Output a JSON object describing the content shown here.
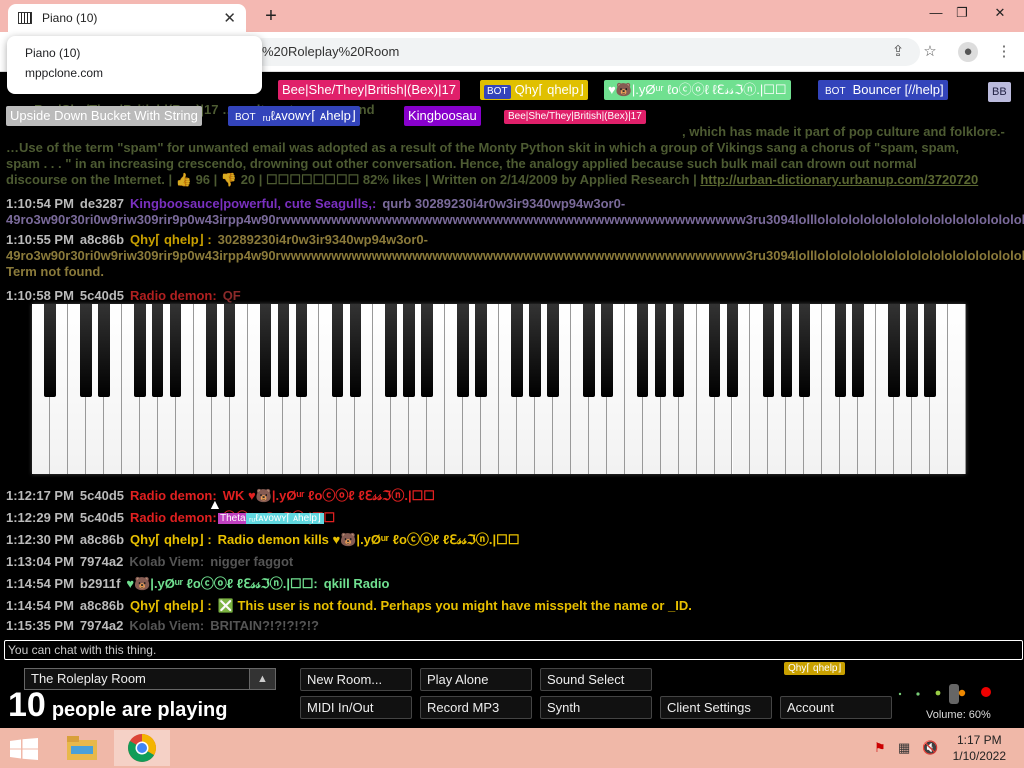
{
  "browser": {
    "tab_title": "Piano (10)",
    "new_tab": "+",
    "url": "%20Roleplay%20Room",
    "tooltip": {
      "title": "Piano (10)",
      "domain": "mppclone.com"
    },
    "win": {
      "min": "—",
      "max": "❐",
      "close": "✕"
    }
  },
  "userbar": {
    "tags": [
      {
        "label": "Bee|She/They|British|(Bex)|17",
        "bg": "#e0206a"
      },
      {
        "label": "Qhy⌈ qhelp⌋",
        "bg": "#e0c000",
        "bot": "BOT"
      },
      {
        "label": "♥🐻|.yØᵘʳ ℓoⓒⓞℓ ℓℇ𝓈𝓈ℑⓝ.|☐☐",
        "bg": "#70e090"
      },
      {
        "label": "Bouncer [//help]",
        "bg": "#3344bb",
        "bot": "BOT"
      },
      {
        "label": "BB",
        "bg": "#bbd"
      },
      {
        "label": "Upside Down Bucket With String",
        "bg": "#bbbbbb"
      },
      {
        "label": "ᵣᵤℓᴀᴠᴏᴡʏ⌈ ᴀhelp⌋",
        "bg": "#3344bb",
        "bot": "BOT"
      },
      {
        "label": "Kingboosau",
        "bg": "#8800cc"
      },
      {
        "label": "Bee|She/They|British|(Bex)|17",
        "bg": "#e0206a"
      }
    ]
  },
  "ghost": {
    "line1": "…m Bee|She/They|British|(Bex)|17 …, salt, water, sugar and",
    "line2": "…Use of the term \"spam\" for unwanted email was adopted as a result of the Monty Python skit in which a group of Vikings sang a chorus of \"spam, spam,",
    "line3": "spam . . . \" in an increasing crescendo, drowning out other conversation. Hence, the analogy applied because such bulk mail can drown out normal",
    "line4": "discourse on the Internet. | 👍 96 | 👎 20 | ☐☐☐☐☐☐☐☐ 82% likes | Written on 2/14/2009 by Applied Research |",
    "link": "http://urban-dictionary.urbanup.com/3720720",
    "extra": ", which has made it part of pop culture and folklore.-"
  },
  "chat": [
    {
      "time": "1:10:54 PM",
      "id": "de3287",
      "name": "Kingboosauce|powerful, cute Seagulls,:",
      "nameColor": "#7a30c0",
      "msg": "qurb 30289230i4r0w3ir9340wp94w3or0-",
      "msgColor": "#7a6a9a"
    },
    {
      "time": "",
      "id": "",
      "name": "",
      "nameColor": "#888",
      "msg": "49ro3w90r30ri0w9riw309rir9p0w43irpp4w90rwwwwwwwwwwwwwwwwwwwwwwwwwwwwwwwwwwwwwwwwwwwwww3ru3094lolllolololololololololololololololololol",
      "msgColor": "#7a6a9a"
    },
    {
      "time": "1:10:55 PM",
      "id": "a8c86b",
      "name": "Qhy⌈ qhelp⌋ :",
      "nameColor": "#c8a000",
      "msg": "30289230i4r0w3ir9340wp94w3or0-",
      "msgColor": "#8a7a3a"
    },
    {
      "time": "",
      "id": "",
      "name": "",
      "nameColor": "#888",
      "msg": "49ro3w90r30ri0w9riw309rir9p0w43irpp4w90rwwwwwwwwwwwwwwwwwwwwwwwwwwwwwwwwwwwwwwwwwwwwww3ru3094lolllolololololololololololololololololol",
      "msgColor": "#8a7a3a"
    },
    {
      "time": "",
      "id": "",
      "name": "",
      "nameColor": "#888",
      "msg": "Term not found.",
      "msgColor": "#8a7a3a"
    },
    {
      "time": "1:10:58 PM",
      "id": "5c40d5",
      "name": "Radio demon:",
      "nameColor": "#b02020",
      "msg": "QF",
      "msgColor": "#8a2a2a"
    }
  ],
  "chat2": [
    {
      "time": "1:12:17 PM",
      "id": "5c40d5",
      "name": "Radio demon:",
      "nameColor": "#e02020",
      "msg": "WK ♥🐻|.yØᵘʳ ℓoⓒⓞℓ ℓℇ𝓈𝓈ℑⓝ.|☐☐",
      "msgColor": "#e02020"
    },
    {
      "time": "1:12:29 PM",
      "id": "5c40d5",
      "name": "Radio demon:",
      "nameColor": "#e02020",
      "msg": "ⓒⓞℓ ℓℇ𝓈𝓈ℑⓝ.|☐☐",
      "msgColor": "#e02020"
    },
    {
      "time": "1:12:30 PM",
      "id": "a8c86b",
      "name": "Qhy⌈ qhelp⌋ :",
      "nameColor": "#e8c000",
      "msg": "Radio demon kills ♥🐻|.yØᵘʳ ℓoⓒⓞℓ ℓℇ𝓈𝓈ℑⓝ.|☐☐",
      "msgColor": "#e8c000"
    },
    {
      "time": "1:13:04 PM",
      "id": "7974a2",
      "name": "Kolab Viem:",
      "nameColor": "#555",
      "msg": "nigger faggot",
      "msgColor": "#555"
    },
    {
      "time": "1:14:54 PM",
      "id": "b2911f",
      "name": "♥🐻|.yØᵘʳ ℓoⓒⓞℓ ℓℇ𝓈𝓈ℑⓝ.|☐☐:",
      "nameColor": "#70e090",
      "msg": "qkill Radio",
      "msgColor": "#70e090"
    },
    {
      "time": "1:14:54 PM",
      "id": "a8c86b",
      "name": "Qhy⌈ qhelp⌋ :",
      "nameColor": "#e8c000",
      "msg": "❎ This user is not found. Perhaps you might have misspelt the name or _ID.",
      "msgColor": "#e8c000"
    },
    {
      "time": "1:15:35 PM",
      "id": "7974a2",
      "name": "Kolab Viem:",
      "nameColor": "#555",
      "msg": "BRITAIN?!?!?!?!?",
      "msgColor": "#555"
    }
  ],
  "cursor_tags": {
    "theta": "Theta",
    "name": "ᵣᵤℓᴀᴠᴏᴡʏ⌈ ᴀhelp⌋",
    "qhy": "Qhy⌈ qhelp⌋"
  },
  "input": {
    "placeholder": "You can chat with this thing."
  },
  "controls": {
    "room": "The Roleplay Room",
    "count": "10",
    "count_text": "people are playing",
    "new_room": "New Room...",
    "play_alone": "Play Alone",
    "sound_select": "Sound Select",
    "midi": "MIDI In/Out",
    "record": "Record MP3",
    "synth": "Synth",
    "client_settings": "Client Settings",
    "account": "Account",
    "volume": "Volume: 60%"
  },
  "taskbar": {
    "time": "1:17 PM",
    "date": "1/10/2022"
  },
  "colors": {
    "chrome": "#f4b8b2",
    "taskbar": "#f0b8a8",
    "accent": "#c8a000"
  }
}
